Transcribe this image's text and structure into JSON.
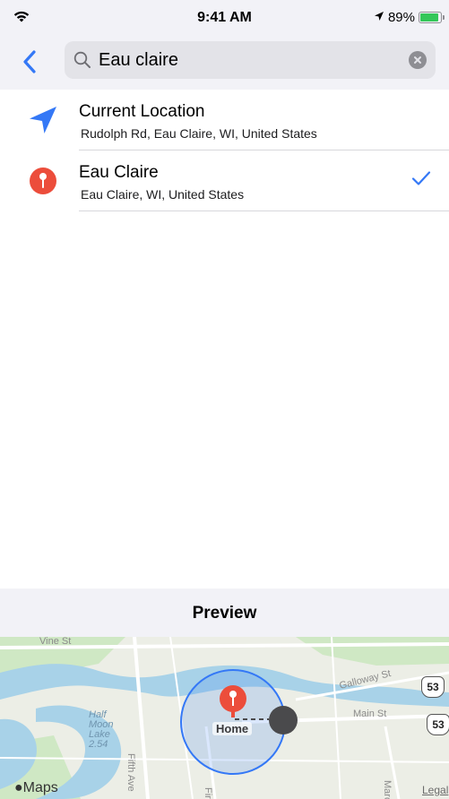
{
  "status_bar": {
    "time": "9:41 AM",
    "battery": "89%",
    "battery_level": 0.89,
    "icons": [
      "wifi-icon",
      "location-arrow-icon",
      "battery-icon"
    ]
  },
  "search": {
    "value": "Eau claire",
    "icons": [
      "back-chevron-icon",
      "magnifier-icon",
      "clear-icon"
    ]
  },
  "results": [
    {
      "title": "Current Location",
      "subtitle": "Rudolph Rd, Eau Claire, WI, United States",
      "icon": "location-arrow-icon",
      "selected": false
    },
    {
      "title": "Eau Claire",
      "subtitle": "Eau Claire, WI, United States",
      "icon": "pin-icon",
      "selected": true
    }
  ],
  "preview": {
    "title": "Preview"
  },
  "map": {
    "pin_label": "Home",
    "logo": "Maps",
    "legal": "Legal",
    "streets": [
      "Vine St",
      "Galloway St",
      "Main St",
      "Fifth Ave",
      "Firs",
      "Marc"
    ],
    "water_label": "Half Moon Lake 2.54",
    "water_lines": [
      "Half",
      "Moon",
      "Lake",
      "2.54"
    ],
    "route_shields": [
      "53",
      "53"
    ],
    "colors": {
      "water": "#a8d2e8",
      "park": "#cfe8c4",
      "radius": "#3478f6",
      "pin": "#ec4d3b"
    }
  },
  "colors": {
    "accent": "#3478f6",
    "header_bg": "#f2f2f7",
    "battery": "#34c759"
  }
}
